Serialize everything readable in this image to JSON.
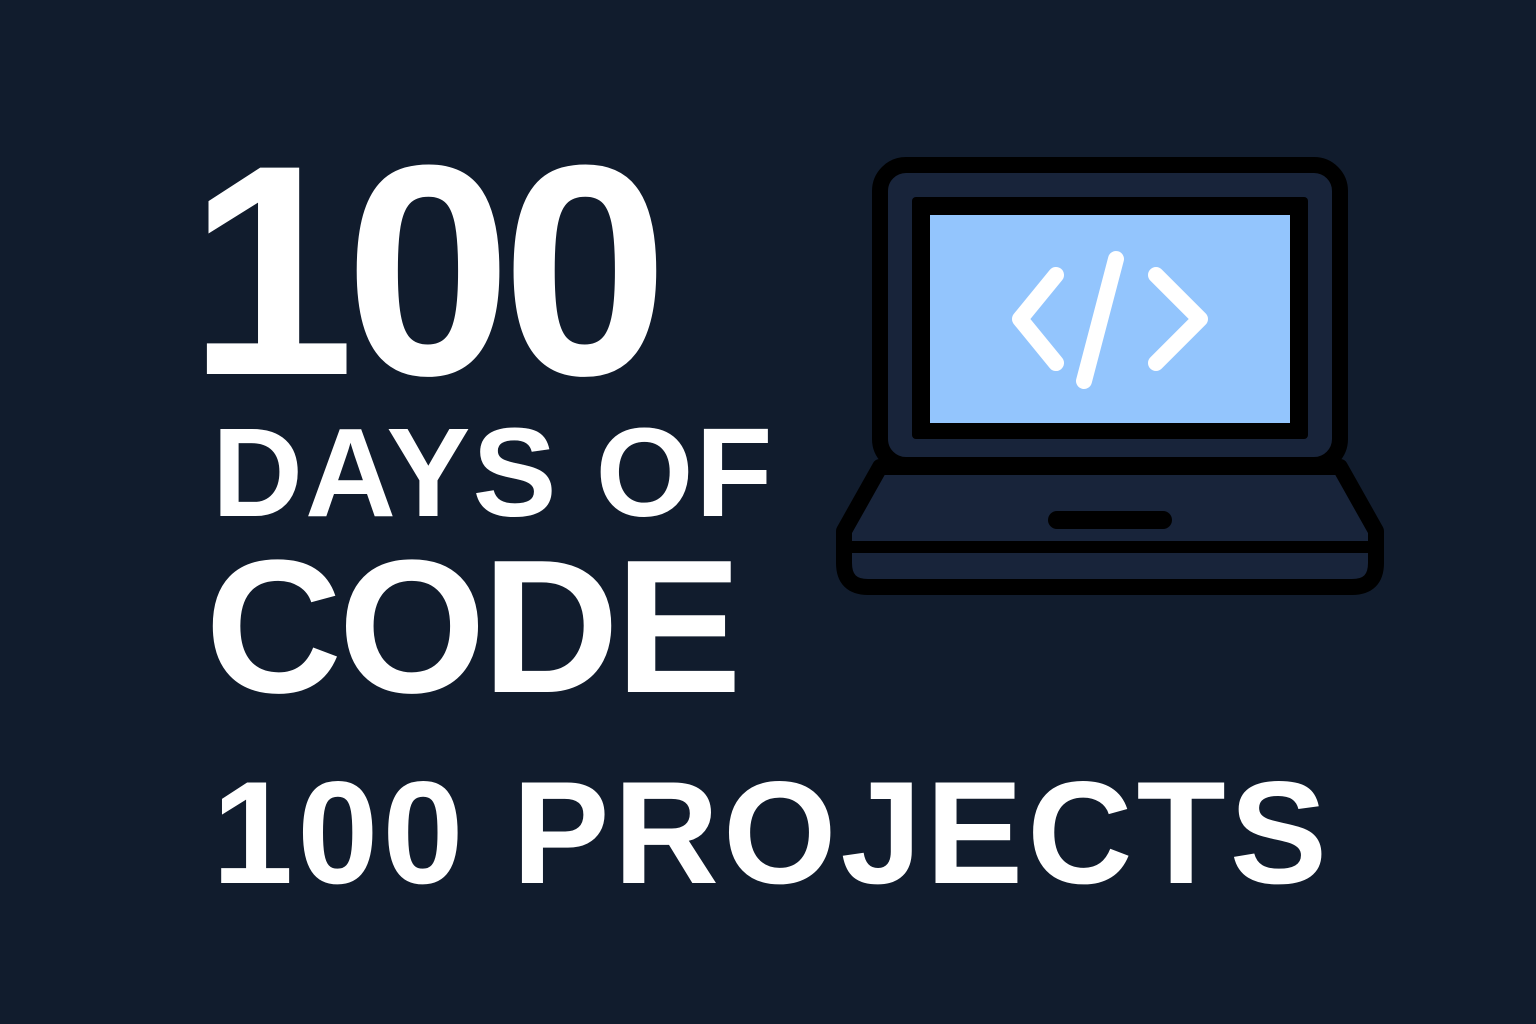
{
  "hero": {
    "line1": "100",
    "line2": "DAYS OF",
    "line3": "CODE",
    "line4": "100 PROJECTS"
  },
  "illustration": {
    "icon": "laptop-icon",
    "screen_glyph": "code-brackets-icon"
  },
  "colors": {
    "background": "#111c2d",
    "text": "#ffffff",
    "screen": "#93c5fd",
    "laptop_body": "#18243a",
    "outline": "#000000"
  }
}
